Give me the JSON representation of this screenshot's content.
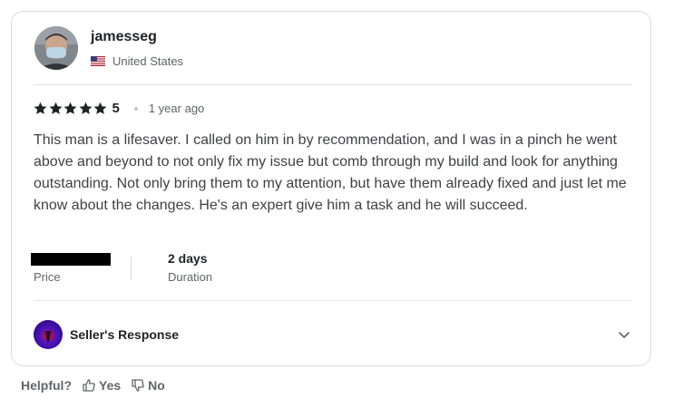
{
  "review": {
    "username": "jamesseg",
    "country": "United States",
    "rating": "5",
    "stars_filled": 5,
    "time_ago": "1 year ago",
    "text": "This man is a lifesaver. I called on him in by recommendation, and I was in a pinch he went above and beyond to not only fix my issue but comb through my build and look for anything outstanding. Not only bring them to my attention, but have them already fixed and just let me know about the changes. He's an expert give him a task and he will succeed.",
    "price_label": "Price",
    "duration_value": "2 days",
    "duration_label": "Duration"
  },
  "seller_response": {
    "label": "Seller's Response"
  },
  "helpful": {
    "question": "Helpful?",
    "yes_label": "Yes",
    "no_label": "No"
  },
  "colors": {
    "text_dark": "#222325",
    "text_muted": "#62646a",
    "border": "#dadbdd"
  }
}
